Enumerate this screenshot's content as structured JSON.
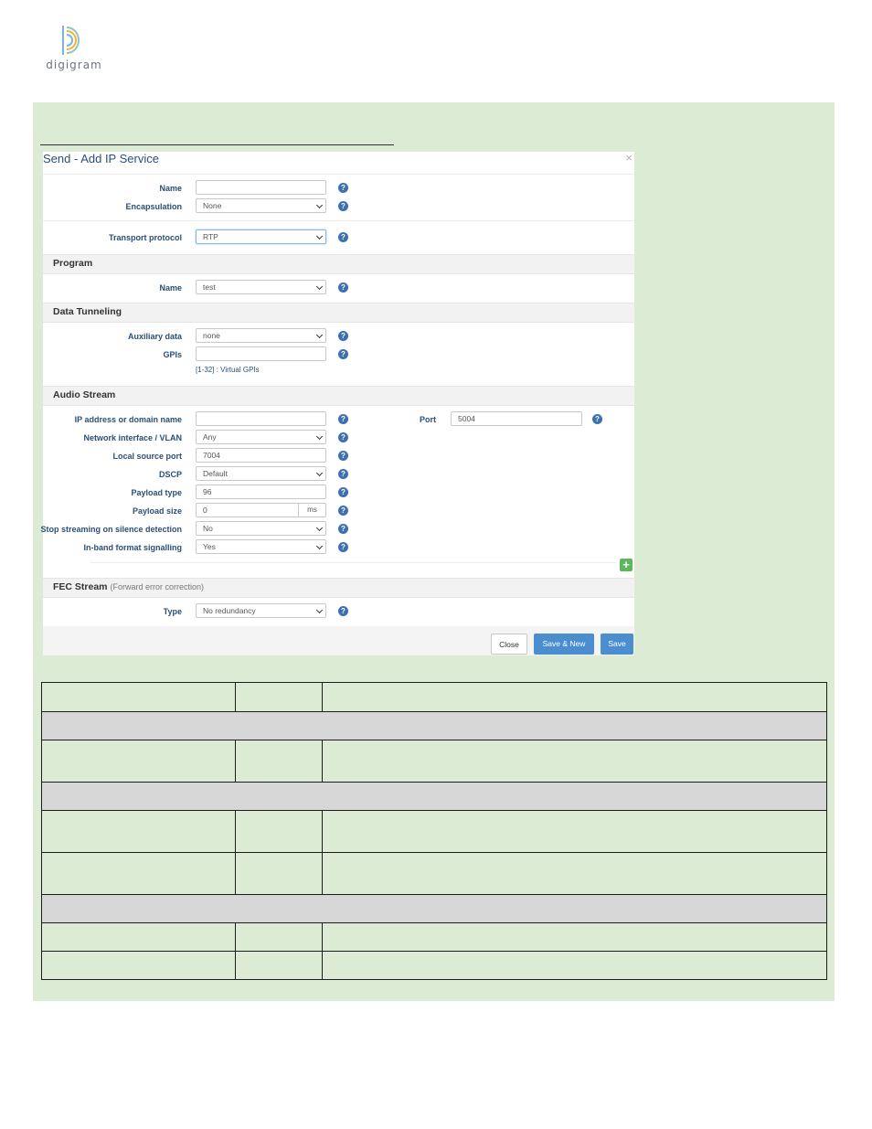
{
  "brand": {
    "logo_text": "digigram"
  },
  "dialog": {
    "title": "Send - Add IP Service",
    "close_glyph": "×",
    "fields": {
      "name": {
        "label": "Name",
        "value": ""
      },
      "encapsulation": {
        "label": "Encapsulation",
        "value": "None"
      },
      "transport_protocol": {
        "label": "Transport protocol",
        "value": "RTP"
      }
    },
    "sections": {
      "program": {
        "title": "Program",
        "name": {
          "label": "Name",
          "value": "test"
        }
      },
      "data_tunneling": {
        "title": "Data Tunneling",
        "auxiliary_data": {
          "label": "Auxiliary data",
          "value": "none"
        },
        "gpis": {
          "label": "GPIs",
          "value": "",
          "hint": "[1-32] : Virtual GPIs"
        }
      },
      "audio_stream": {
        "title": "Audio Stream",
        "ip_address": {
          "label": "IP address or domain name",
          "value": ""
        },
        "port": {
          "label": "Port",
          "value": "5004"
        },
        "network_interface": {
          "label": "Network interface / VLAN",
          "value": "Any"
        },
        "local_source_port": {
          "label": "Local source port",
          "value": "7004"
        },
        "dscp": {
          "label": "DSCP",
          "value": "Default"
        },
        "payload_type": {
          "label": "Payload type",
          "value": "96"
        },
        "payload_size": {
          "label": "Payload size",
          "value": "0",
          "unit": "ms"
        },
        "stop_on_silence": {
          "label": "Stop streaming on silence detection",
          "value": "No"
        },
        "inband_format": {
          "label": "In-band format signalling",
          "value": "Yes"
        }
      },
      "fec_stream": {
        "title": "FEC Stream",
        "subtitle": "(Forward error correction)",
        "type": {
          "label": "Type",
          "value": "No redundancy"
        }
      }
    },
    "help_glyph": "?",
    "add_glyph": "+",
    "buttons": {
      "close": "Close",
      "save_new": "Save & New",
      "save": "Save"
    }
  },
  "colors": {
    "band": "#dbebd4",
    "label": "#2a4f78",
    "help_icon": "#3d70b2",
    "primary_button": "#4a8ed0",
    "add_button": "#5cb85c",
    "table_section_row": "#d7d7d7"
  }
}
